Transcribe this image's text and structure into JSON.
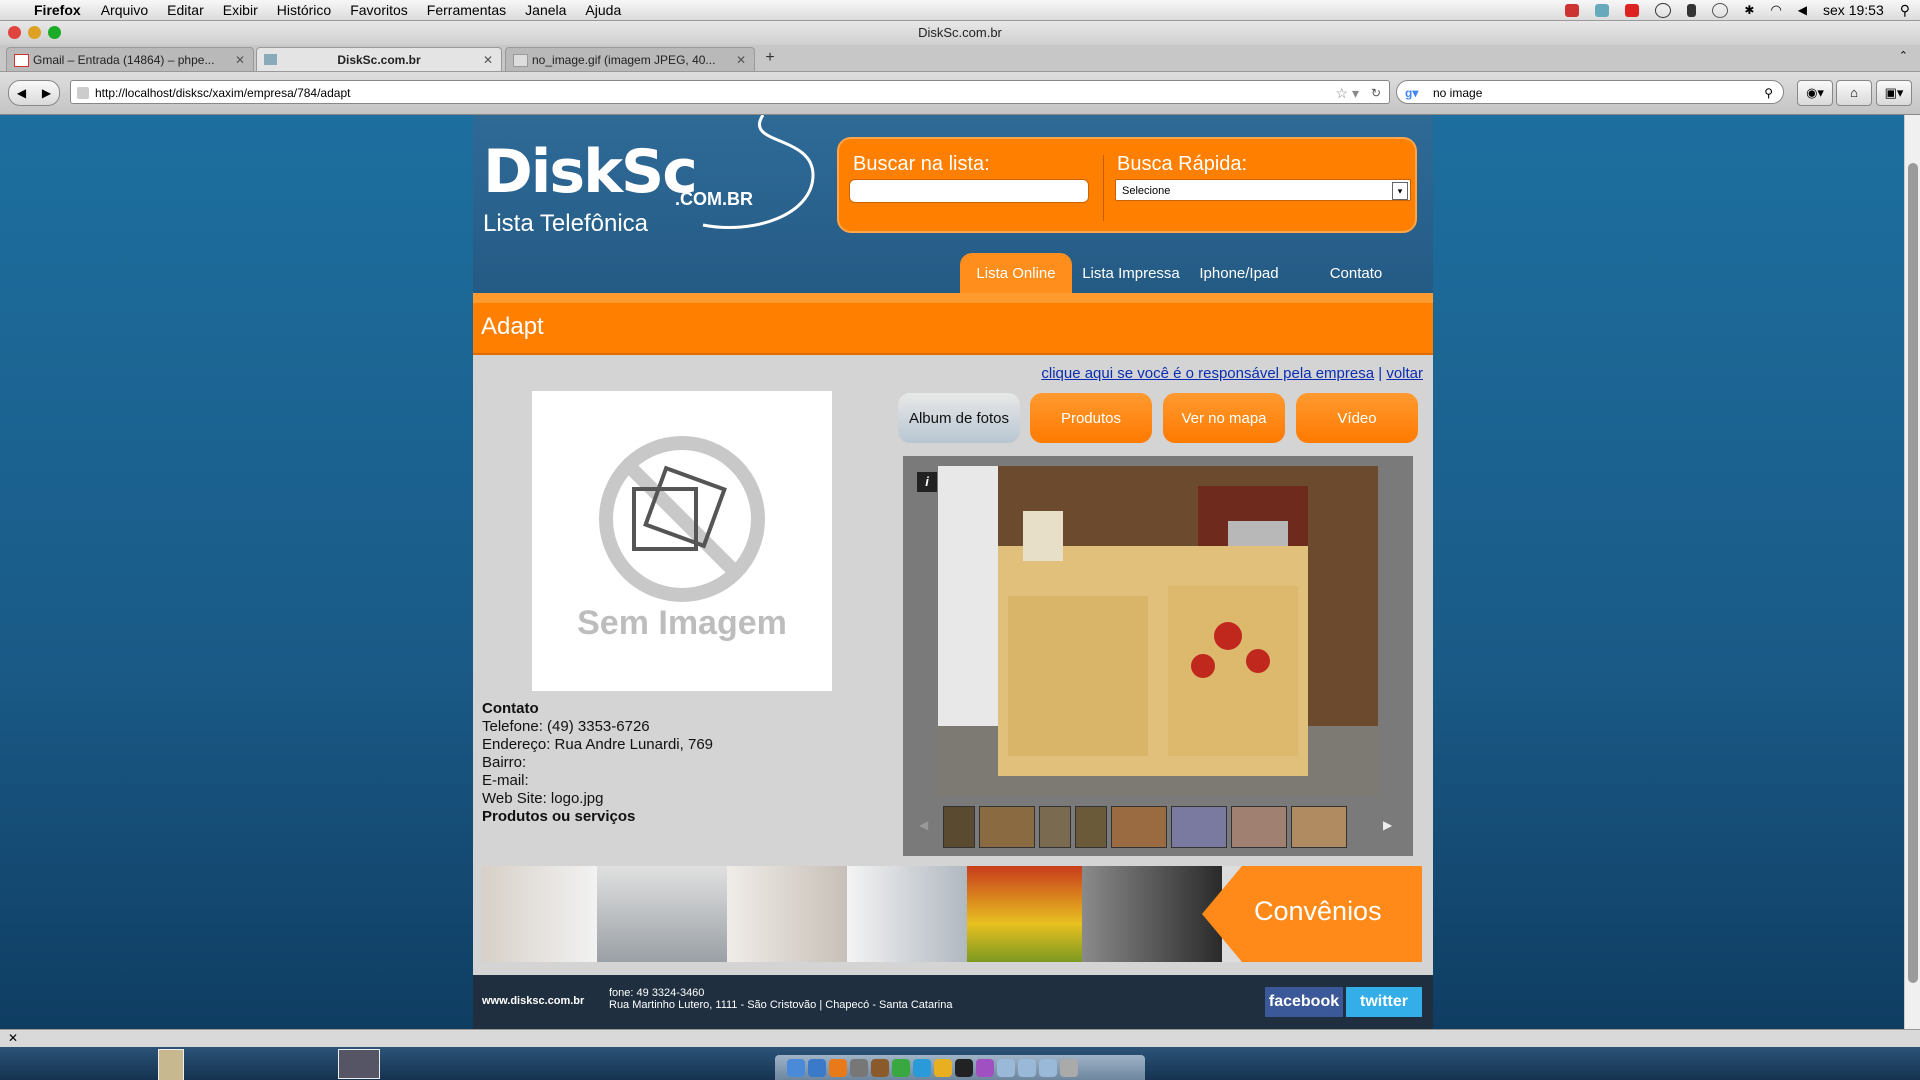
{
  "menubar": {
    "app": "Firefox",
    "items": [
      "Arquivo",
      "Editar",
      "Exibir",
      "Histórico",
      "Favoritos",
      "Ferramentas",
      "Janela",
      "Ajuda"
    ],
    "clock": "sex 19:53"
  },
  "window": {
    "title": "DiskSc.com.br"
  },
  "tabs": [
    {
      "label": "Gmail – Entrada (14864) – phpe...",
      "icon": "gmail-icon"
    },
    {
      "label": "DiskSc.com.br",
      "icon": "page-icon"
    },
    {
      "label": "no_image.gif (imagem JPEG, 40...",
      "icon": "image-icon"
    }
  ],
  "navigation": {
    "url": "http://localhost/disksc/xaxim/empresa/784/adapt",
    "search_value": "no image"
  },
  "site": {
    "logo": "DiskSc",
    "logo_domain": ".COM.BR",
    "tagline": "Lista Telefônica",
    "search": {
      "list_label": "Buscar na lista:",
      "quick_label": "Busca Rápida:",
      "quick_value": "Selecione"
    },
    "nav": [
      "Lista Online",
      "Lista Impressa",
      "Iphone/Ipad",
      "Contato"
    ],
    "company_title": "Adapt",
    "links": {
      "responsible": "clique aqui se você é o responsável pela empresa",
      "separator": "|",
      "back": "voltar"
    },
    "no_image_text": "Sem Imagem",
    "buttons": {
      "album": "Album de fotos",
      "products": "Produtos",
      "map": "Ver no mapa",
      "video": "Vídeo"
    },
    "contact": {
      "heading": "Contato",
      "phone": "Telefone: (49) 3353-6726",
      "address": "Endereço: Rua Andre Lunardi, 769",
      "district": "Bairro:",
      "email": "E-mail:",
      "website": "Web Site: logo.jpg",
      "products_heading": "Produtos ou serviços"
    },
    "gallery_info": "i",
    "banner_text": "Convênios",
    "footer": {
      "url": "www.disksc.com.br",
      "phone": "fone: 49 3324-3460",
      "address": "Rua Martinho Lutero, 1111 - São Cristovão | Chapecó - Santa Catarina",
      "facebook": "facebook",
      "twitter": "twitter"
    }
  }
}
